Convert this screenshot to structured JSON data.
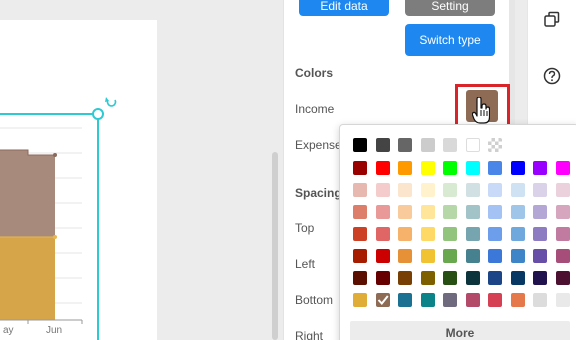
{
  "chart_data": {
    "type": "area",
    "x": [
      "May",
      "Jun"
    ],
    "series": [
      {
        "name": "Income",
        "color": "#a88a7d"
      },
      {
        "name": "Expense",
        "color": "#d6a54a"
      }
    ],
    "tick_labels": [
      "ay",
      "Jun"
    ]
  },
  "panel": {
    "edit_label": "Edit data",
    "setting_label": "Setting",
    "switch_label": "Switch type",
    "colors_title": "Colors",
    "income_label": "Income",
    "expense_label": "Expense",
    "income_color": "#8d6b55",
    "spacing_title": "Spacing",
    "top_label": "Top",
    "left_label": "Left",
    "bottom_label": "Bottom",
    "right_label": "Right"
  },
  "toolbar": {
    "icons": [
      "copy-icon",
      "help-icon"
    ]
  },
  "picker": {
    "more_label": "More",
    "selected": "#8d6b55",
    "rows": [
      [
        "#000000",
        "#444444",
        "#666666",
        "#cccccc",
        "#d9d9d9",
        "#ffffff",
        "transparent"
      ],
      [
        "#990000",
        "#ff0000",
        "#ff9900",
        "#ffff00",
        "#00ff00",
        "#00ffff",
        "#4a86e8",
        "#0000ff",
        "#9900ff",
        "#ff00ff"
      ],
      [
        "#e6b8af",
        "#f4cccc",
        "#fce5cd",
        "#fff2cc",
        "#d9ead3",
        "#d0e0e3",
        "#c9daf8",
        "#cfe2f3",
        "#d9d2e9",
        "#ead1dc"
      ],
      [
        "#dd7e6b",
        "#ea9999",
        "#f9cb9c",
        "#ffe599",
        "#b6d7a8",
        "#a2c4c9",
        "#a4c2f4",
        "#9fc5e8",
        "#b4a7d6",
        "#d5a6bd"
      ],
      [
        "#cc4125",
        "#e06666",
        "#f6b26b",
        "#ffd966",
        "#93c47d",
        "#76a5af",
        "#6d9eeb",
        "#6fa8dc",
        "#8e7cc3",
        "#c27ba0"
      ],
      [
        "#a61c00",
        "#cc0000",
        "#e69138",
        "#f1c232",
        "#6aa84f",
        "#45818e",
        "#3c78d8",
        "#3d85c6",
        "#674ea7",
        "#a64d79"
      ],
      [
        "#5b0f00",
        "#660000",
        "#783f04",
        "#7f6000",
        "#274e13",
        "#0c343d",
        "#1c4587",
        "#073763",
        "#20124d",
        "#4c1130"
      ],
      [
        "#e0ad38",
        "#8d6b55",
        "#1b7192",
        "#0c8289",
        "#6f6a7e",
        "#b34a69",
        "#d64055",
        "#e5794b",
        "#dcdcdc",
        "#e9e9e9"
      ]
    ]
  }
}
